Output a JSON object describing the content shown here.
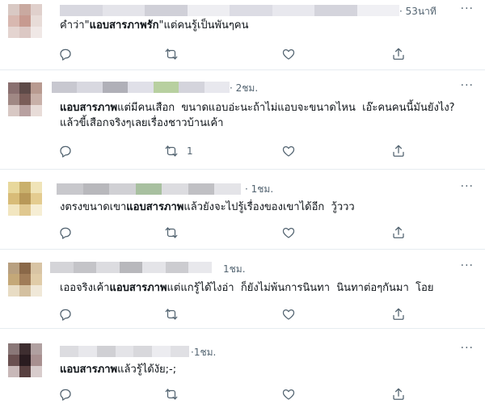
{
  "tweets": [
    {
      "time": "· 53นาที",
      "more": "···",
      "text_parts": [
        "คำว่า\"",
        "แอบสารภาพรัก",
        "\"แต่คนรู้เป็นพันๆคน"
      ],
      "retweet_count": "",
      "avatar_colors": [
        "#d9c9c4",
        "#c9a9a0",
        "#e0d0cc",
        "#d8b8b0",
        "#c79a90",
        "#e8dcd8",
        "#e4d4d0",
        "#dcc8c4",
        "#f0e8e6"
      ],
      "name_colors": [
        "#d8d8e0",
        "#e4e4ea",
        "#d0d0d8",
        "#eeeef2",
        "#dcdce4",
        "#e8e8ee",
        "#d4d4dc",
        "#f0f0f4"
      ]
    },
    {
      "time": "· 2ชม.",
      "more": "···",
      "text_parts": [
        "",
        "แอบสารภาพ",
        "แต่มีคนเสือก  ขนาดแอบอ่ะนะถ้าไม่แอบจะขนาดไหน  เอ๊ะคนคนนี้มันยังไง? แล้วขี้เสือกจริงๆเลยเรื่องชาวบ้านเค้า"
      ],
      "retweet_count": "1",
      "avatar_colors": [
        "#8a7070",
        "#5e4a48",
        "#b89a90",
        "#a08884",
        "#7a5c58",
        "#c8b0a8",
        "#d8c8c4",
        "#b8a0a0",
        "#e8dcd8"
      ],
      "name_colors": [
        "#c8c8d0",
        "#d8d8e0",
        "#b0b0b8",
        "#e0e0e8",
        "#b8d0a0",
        "#d4d4dc",
        "#e8e8ee"
      ]
    },
    {
      "time": "· 1ชม.",
      "more": "···",
      "text_parts": [
        "งตรงขนาดเขา",
        "แอบสารภาพ",
        "แล้วยังจะไปรู้เรื่องของเขาได้อีก  วู้ววว"
      ],
      "retweet_count": "",
      "avatar_colors": [
        "#e8d89c",
        "#c9b06c",
        "#f0e4b8",
        "#d8bc78",
        "#b89858",
        "#e4cc90",
        "#f2e6c0",
        "#e0c890",
        "#f6eed4"
      ],
      "name_colors": [
        "#c8c8cc",
        "#b8b8bc",
        "#d0d0d4",
        "#a8c0a0",
        "#dcdce0",
        "#c0c0c4",
        "#e4e4e8"
      ]
    },
    {
      "time": "1ชม.",
      "more": "···",
      "text_parts": [
        "เออจริงเค้า",
        "แอบสารภาพ",
        "แต่แกรู้ได้ไงอ่า  ก็ยังไม่พ้นการนินทา  นินทาต่อๆกันมา  โอย"
      ],
      "retweet_count": "",
      "avatar_colors": [
        "#b8a080",
        "#8a6848",
        "#d8c4a4",
        "#c4a878",
        "#a07c58",
        "#e0cca8",
        "#e8dcc4",
        "#d4c0a0",
        "#f0e8d8"
      ],
      "name_colors": [
        "#d4d4d8",
        "#c4c4c8",
        "#dcdce0",
        "#b8b8bc",
        "#e4e4e8",
        "#ccccd0",
        "#e8e8ec"
      ]
    },
    {
      "time": "·1ชม.",
      "more": "···",
      "text_parts": [
        "",
        "แอบสารภาพ",
        "แล้วรู้ได้งัย;-;"
      ],
      "retweet_count": "",
      "avatar_colors": [
        "#8a7878",
        "#3e2e30",
        "#b0a0a0",
        "#6a5050",
        "#2a1c20",
        "#a89090",
        "#c8b8b8",
        "#584040",
        "#d8cccc"
      ],
      "name_colors": [
        "#dcdce0",
        "#e8e8ec",
        "#d0d0d4",
        "#e4e4e8",
        "#d8d8dc",
        "#ececf0",
        "#e0e0e4"
      ]
    }
  ]
}
